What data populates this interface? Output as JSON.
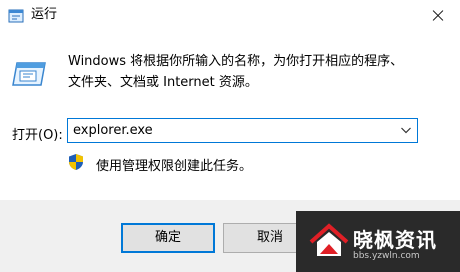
{
  "window": {
    "title": "运行"
  },
  "description": {
    "line1": "Windows 将根据你所输入的名称，为你打开相应的程序、",
    "line2": "文件夹、文档或 Internet 资源。"
  },
  "open": {
    "label": "打开(O):",
    "value": "explorer.exe"
  },
  "admin_note": "使用管理权限创建此任务。",
  "buttons": {
    "ok": "确定",
    "cancel": "取消"
  },
  "watermark": {
    "title": "晓枫资讯",
    "url": "bbs.yzwln.com"
  },
  "icons": {
    "app": "run-app-icon",
    "run": "run-icon",
    "shield": "uac-shield-icon",
    "dropdown": "chevron-down-icon",
    "close": "close-icon"
  },
  "colors": {
    "accent": "#0078d7",
    "footer_bg": "#f0f0f0",
    "watermark_red": "#e01f26"
  }
}
